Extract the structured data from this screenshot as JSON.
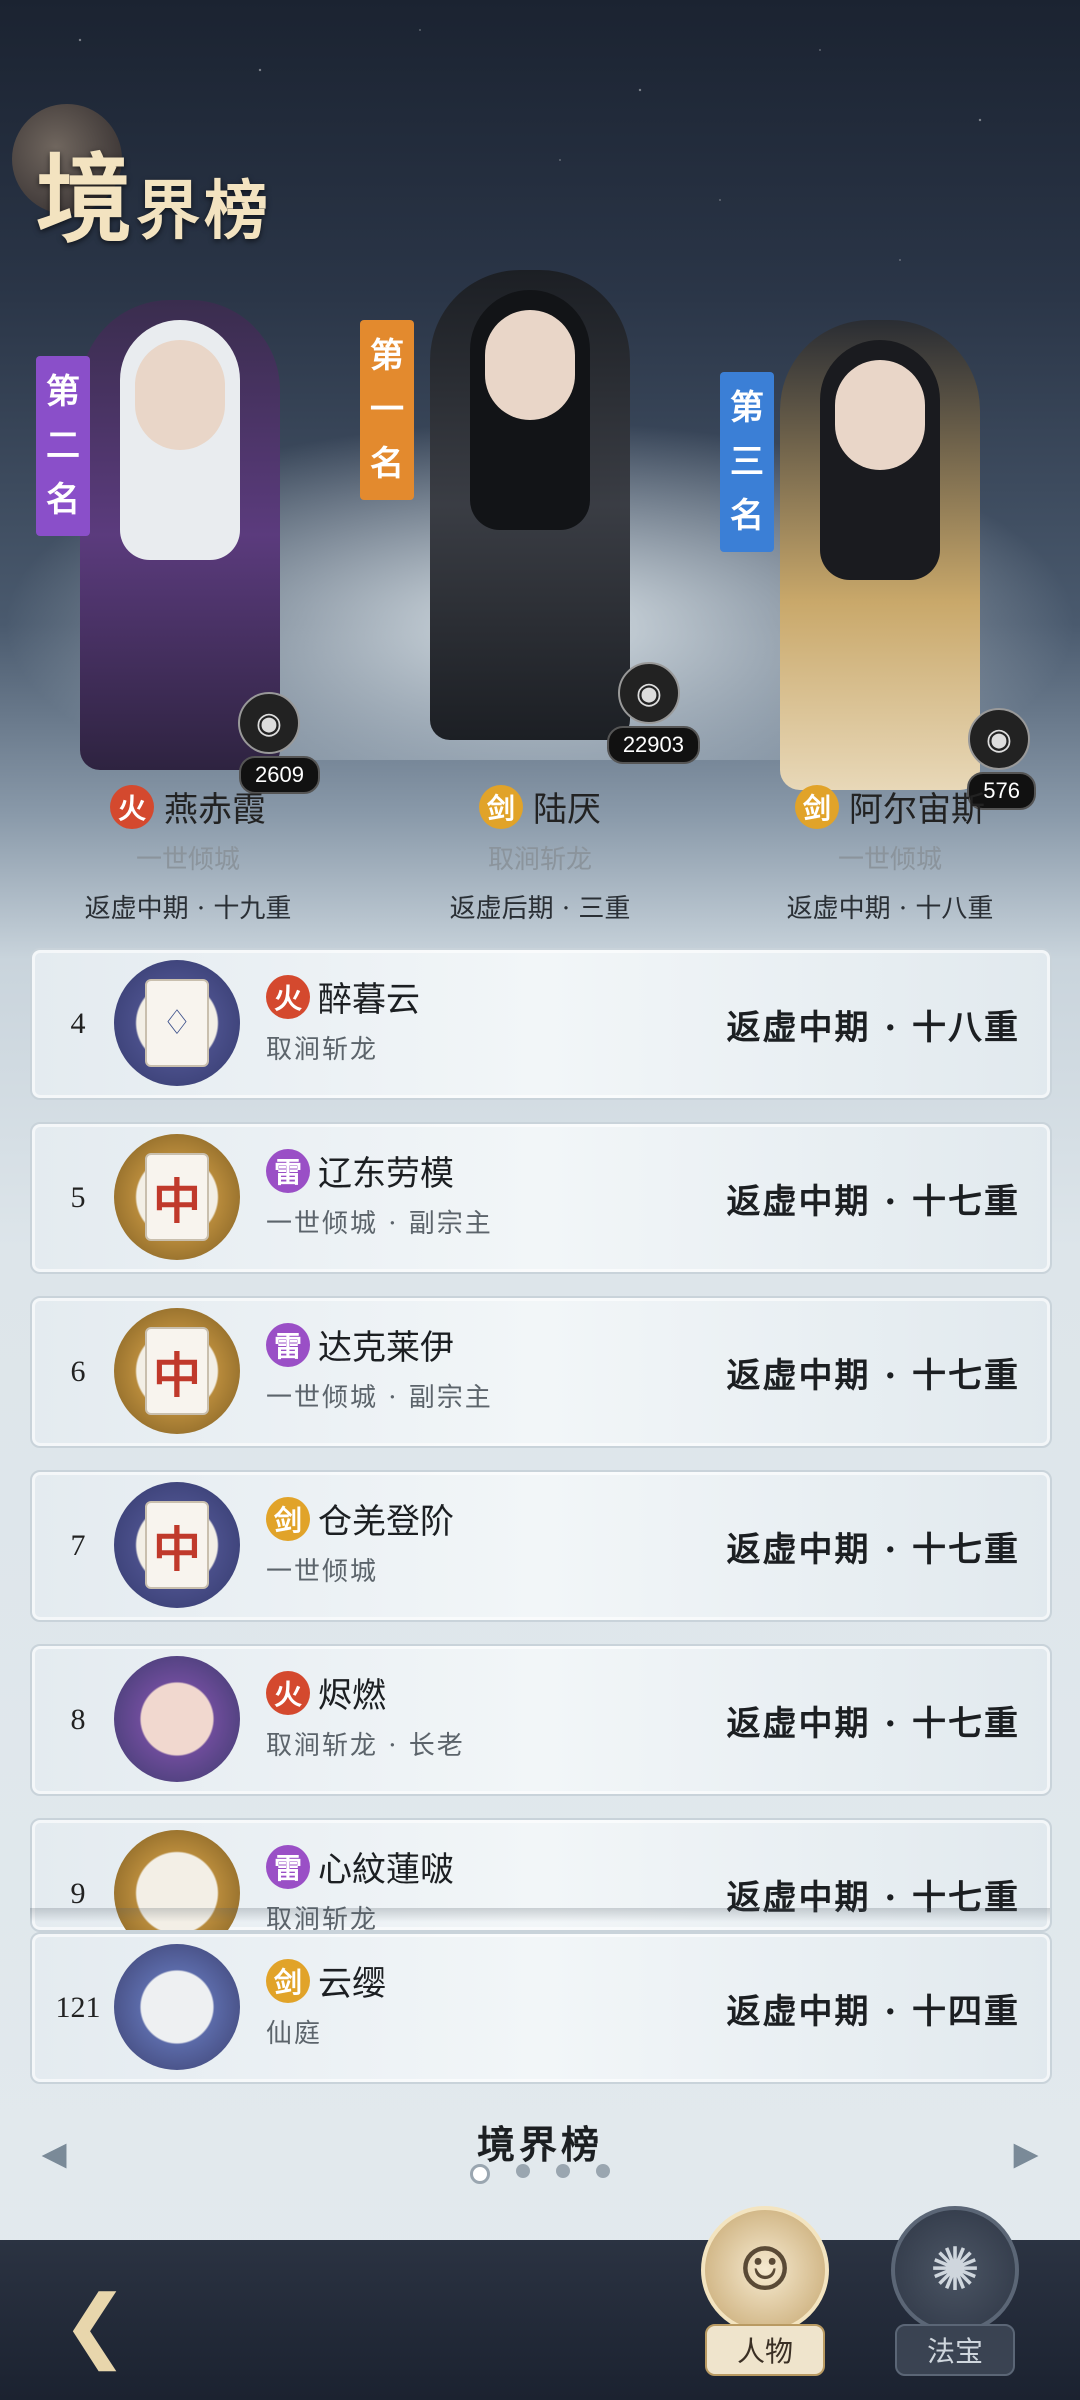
{
  "header": {
    "title_first": "境",
    "title_rest": "界榜"
  },
  "podium": [
    {
      "banner": [
        "第",
        "二",
        "名"
      ],
      "score": "2609",
      "element": "火",
      "element_type": "fire",
      "name": "燕赤霞",
      "guild": "一世倾城",
      "realm": "返虚中期 · 十九重"
    },
    {
      "banner": [
        "第",
        "一",
        "名"
      ],
      "score": "22903",
      "element": "剑",
      "element_type": "sword",
      "name": "陆厌",
      "guild": "取涧斩龙",
      "realm": "返虚后期 · 三重"
    },
    {
      "banner": [
        "第",
        "三",
        "名"
      ],
      "score": "576",
      "element": "剑",
      "element_type": "sword",
      "name": "阿尔宙斯",
      "guild": "一世倾城",
      "realm": "返虚中期 · 十八重"
    }
  ],
  "rows": [
    {
      "rank": "4",
      "element": "火",
      "element_type": "fire",
      "name": "醉暮云",
      "guild": "取涧斩龙",
      "realm": "返虚中期 · 十八重",
      "avatar": "card",
      "tile": "♢"
    },
    {
      "rank": "5",
      "element": "雷",
      "element_type": "thunder",
      "name": "辽东劳模",
      "guild": "一世倾城 · 副宗主",
      "realm": "返虚中期 · 十七重",
      "avatar": "gold",
      "tile": "中"
    },
    {
      "rank": "6",
      "element": "雷",
      "element_type": "thunder",
      "name": "达克莱伊",
      "guild": "一世倾城 · 副宗主",
      "realm": "返虚中期 · 十七重",
      "avatar": "gold",
      "tile": "中"
    },
    {
      "rank": "7",
      "element": "剑",
      "element_type": "sword",
      "name": "仓羌登阶",
      "guild": "一世倾城",
      "realm": "返虚中期 · 十七重",
      "avatar": "blue",
      "tile": "中"
    },
    {
      "rank": "8",
      "element": "火",
      "element_type": "fire",
      "name": "烬燃",
      "guild": "取涧斩龙 · 长老",
      "realm": "返虚中期 · 十七重",
      "avatar": "portrait",
      "tile": ""
    },
    {
      "rank": "9",
      "element": "雷",
      "element_type": "thunder",
      "name": "心紋蓮啵",
      "guild": "取涧斩龙",
      "realm": "返虚中期 · 十七重",
      "avatar": "gold",
      "tile": ""
    }
  ],
  "self_row": {
    "rank": "121",
    "element": "剑",
    "element_type": "sword",
    "name": "云缨",
    "guild": "仙庭",
    "realm": "返虚中期 · 十四重"
  },
  "pager": {
    "title": "境界榜",
    "page_count": 4,
    "active": 0
  },
  "footer": {
    "tab_person": "人物",
    "tab_treasure": "法宝"
  },
  "colors": {
    "fire": "#d4492e",
    "sword": "#e1a329",
    "thunder": "#9a4fc6",
    "banner_purple": "#8a4fc9",
    "banner_orange": "#e38a2e",
    "banner_blue": "#3b7fd6"
  }
}
